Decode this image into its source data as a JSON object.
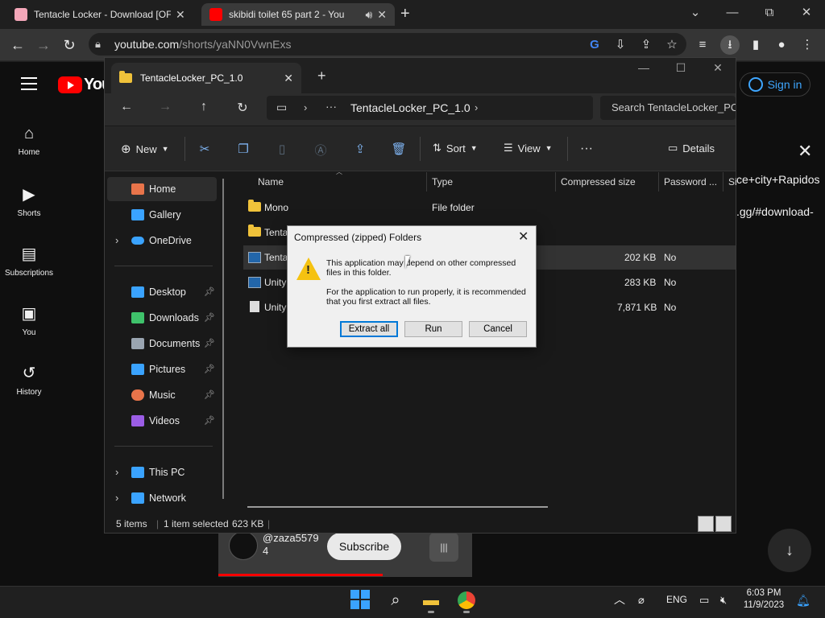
{
  "browser": {
    "tabs": [
      {
        "title": "Tentacle Locker - Download [OF",
        "favicon_color": "#f4a7b9"
      },
      {
        "title": "skibidi toilet 65 part 2 - You",
        "favicon_color": "#ff0000"
      }
    ],
    "new_tab": "+",
    "window_controls": {
      "chevron": "⌄",
      "minimize": "—",
      "restore": "⧉",
      "close": "✕"
    },
    "url_domain": "youtube.com",
    "url_path": "/shorts/yaNN0VwnExs"
  },
  "youtube": {
    "logo_text": "You",
    "sign_in": "Sign in",
    "nav": [
      {
        "label": "Home",
        "icon": "⌂"
      },
      {
        "label": "Shorts",
        "icon": "▶"
      },
      {
        "label": "Subscriptions",
        "icon": "▤"
      },
      {
        "label": "You",
        "icon": "▣"
      },
      {
        "label": "History",
        "icon": "↺"
      }
    ],
    "right_text_1": "ce+city+Rapidos",
    "right_text_2": ".gg/#download-",
    "channel_handle": "@zaza5579\n4",
    "subscribe": "Subscribe"
  },
  "explorer": {
    "tab_title": "TentacleLocker_PC_1.0",
    "breadcrumb": "TentacleLocker_PC_1.0",
    "search_placeholder": "Search TentacleLocker_PC",
    "commands": {
      "new": "New",
      "sort": "Sort",
      "view": "View",
      "details": "Details"
    },
    "nav_items": [
      {
        "label": "Home",
        "color": "#e8744a"
      },
      {
        "label": "Gallery",
        "color": "#3aa3ff"
      },
      {
        "label": "OneDrive",
        "color": "#3aa3ff"
      },
      {
        "label": "Desktop",
        "color": "#3aa3ff"
      },
      {
        "label": "Downloads",
        "color": "#3fc26b"
      },
      {
        "label": "Documents",
        "color": "#9aa5b1"
      },
      {
        "label": "Pictures",
        "color": "#3aa3ff"
      },
      {
        "label": "Music",
        "color": "#e8744a"
      },
      {
        "label": "Videos",
        "color": "#9b5de5"
      },
      {
        "label": "This PC",
        "color": "#3aa3ff"
      },
      {
        "label": "Network",
        "color": "#3aa3ff"
      }
    ],
    "columns": [
      "Name",
      "Type",
      "Compressed size",
      "Password ...",
      "Si"
    ],
    "files": [
      {
        "name": "Mono",
        "type": "File folder",
        "size": "",
        "password": ""
      },
      {
        "name": "Tenta",
        "type": "",
        "size": "",
        "password": ""
      },
      {
        "name": "Tenta",
        "type": "",
        "size": "202 KB",
        "password": "No"
      },
      {
        "name": "Unity",
        "type": "",
        "size": "283 KB",
        "password": "No"
      },
      {
        "name": "Unity",
        "type": "",
        "size": "7,871 KB",
        "password": "No"
      }
    ],
    "status": {
      "items": "5 items",
      "selected": "1 item selected",
      "selected_size": "623 KB"
    }
  },
  "dialog": {
    "title": "Compressed (zipped) Folders",
    "message1": "This application may depend on other compressed files in this folder.",
    "message2": "For the application to run properly, it is recommended that you first extract all files.",
    "buttons": {
      "extract": "Extract all",
      "run": "Run",
      "cancel": "Cancel"
    }
  },
  "taskbar": {
    "tray_lang": "ENG",
    "time": "6:03 PM",
    "date": "11/9/2023"
  }
}
